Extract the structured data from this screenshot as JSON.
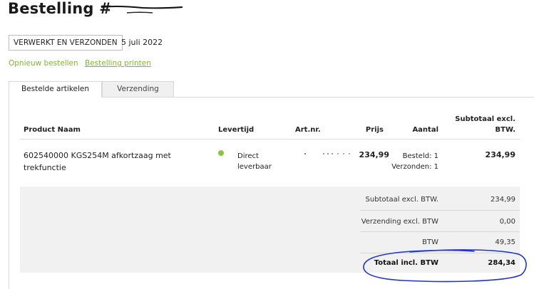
{
  "order": {
    "title": "Bestelling #",
    "status": "VERWERKT EN VERZONDEN",
    "date": "5 juli 2022"
  },
  "links": {
    "reorder": "Opnieuw bestellen",
    "print": "Bestelling printen"
  },
  "tabs": [
    {
      "label": "Bestelde artikelen",
      "active": true
    },
    {
      "label": "Verzending",
      "active": false
    }
  ],
  "table": {
    "headers": {
      "product": "Product Naam",
      "delivery": "Levertijd",
      "artnr": "Art.nr.",
      "price": "Prijs",
      "qty": "Aantal",
      "subtotal_line1": "Subtotaal excl.",
      "subtotal_line2": "BTW."
    },
    "rows": [
      {
        "name": "602540000 KGS254M afkortzaag met trekfunctie",
        "delivery_line1": "Direct",
        "delivery_line2": "leverbaar",
        "price": "234,99",
        "ordered": "Besteld: 1",
        "shipped": "Verzonden: 1",
        "subtotal": "234,99"
      }
    ]
  },
  "totals": [
    {
      "label": "Subtotaal excl. BTW.",
      "value": "234,99"
    },
    {
      "label": "Verzending excl. BTW",
      "value": "0,00"
    },
    {
      "label": "BTW",
      "value": "49,35"
    },
    {
      "label": "Totaal incl. BTW",
      "value": "284,34"
    }
  ],
  "colors": {
    "accent_green": "#7fb431",
    "availability_dot": "#8cc63f",
    "annotation_blue": "#1f35c9"
  },
  "icons": {
    "availability": "green-dot-icon"
  }
}
